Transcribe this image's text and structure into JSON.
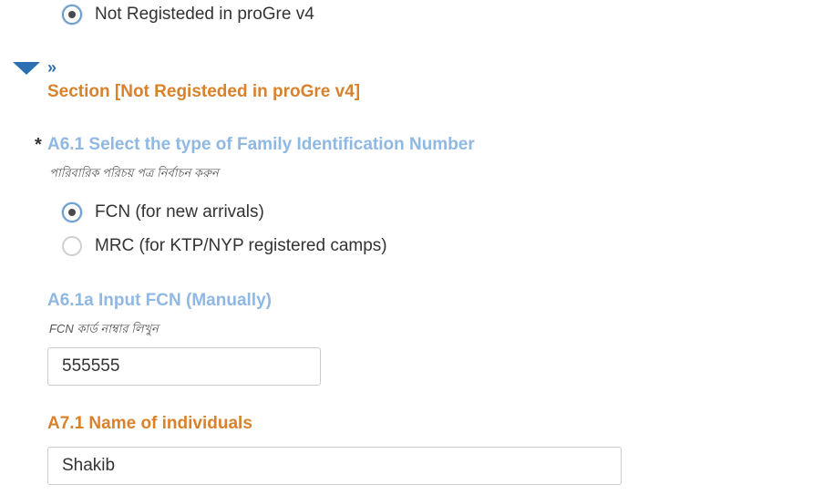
{
  "prev_option": {
    "label": "Not Registeded in proGre v4",
    "checked": true
  },
  "section": {
    "toggle_icon": "caret-down-icon",
    "breadcrumb_glyph": "»",
    "title": "Section [Not Registeded in proGre v4]"
  },
  "q_a6_1": {
    "required_mark": "*",
    "label": "A6.1 Select the type of Family Identification Number",
    "hint": "পারিবারিক পরিচয় পত্র নির্বাচন করুন",
    "options": [
      {
        "label": "FCN (for new arrivals)",
        "checked": true
      },
      {
        "label": "MRC (for KTP/NYP registered camps)",
        "checked": false
      }
    ]
  },
  "q_a6_1a": {
    "label": "A6.1a Input FCN (Manually)",
    "hint": "FCN কার্ড নাম্বার লিখুন",
    "value": "555555"
  },
  "q_a7_1": {
    "label": "A7.1 Name of individuals",
    "value": "Shakib"
  },
  "colors": {
    "question_blue": "#8fb8e3",
    "section_orange": "#d9812b",
    "toggle_blue": "#2a70b3",
    "radio_checked_border": "#6c9dcd"
  }
}
